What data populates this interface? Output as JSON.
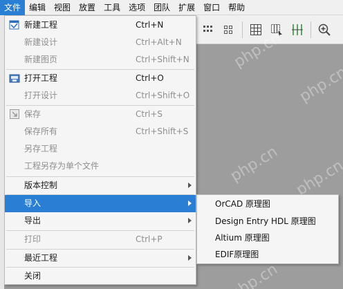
{
  "menubar": {
    "items": [
      "文件",
      "编辑",
      "视图",
      "放置",
      "工具",
      "选项",
      "团队",
      "扩展",
      "窗口",
      "帮助"
    ]
  },
  "file_menu": {
    "items": [
      {
        "label": "新建工程",
        "shortcut": "Ctrl+N",
        "enabled": true,
        "icon": "new-project-icon"
      },
      {
        "label": "新建设计",
        "shortcut": "Ctrl+Alt+N",
        "enabled": false
      },
      {
        "label": "新建图页",
        "shortcut": "Ctrl+Shift+N",
        "enabled": false
      },
      {
        "label": "打开工程",
        "shortcut": "Ctrl+O",
        "enabled": true,
        "icon": "open-project-icon"
      },
      {
        "label": "打开设计",
        "shortcut": "Ctrl+Shift+O",
        "enabled": false
      },
      {
        "label": "保存",
        "shortcut": "Ctrl+S",
        "enabled": false,
        "icon": "save-icon"
      },
      {
        "label": "保存所有",
        "shortcut": "Ctrl+Shift+S",
        "enabled": false
      },
      {
        "label": "另存工程",
        "shortcut": "",
        "enabled": false
      },
      {
        "label": "工程另存为单个文件",
        "shortcut": "",
        "enabled": false
      },
      {
        "label": "版本控制",
        "shortcut": "",
        "enabled": true,
        "submenu": true
      },
      {
        "label": "导入",
        "shortcut": "",
        "enabled": true,
        "submenu": true,
        "highlighted": true
      },
      {
        "label": "导出",
        "shortcut": "",
        "enabled": true,
        "submenu": true
      },
      {
        "label": "打印",
        "shortcut": "Ctrl+P",
        "enabled": false
      },
      {
        "label": "最近工程",
        "shortcut": "",
        "enabled": true,
        "submenu": true
      },
      {
        "label": "关闭",
        "shortcut": "",
        "enabled": true
      }
    ]
  },
  "import_submenu": {
    "items": [
      "OrCAD 原理图",
      "Design Entry HDL 原理图",
      "Altium 原理图",
      "EDIF原理图"
    ]
  },
  "toolbar": {
    "icons": [
      "grid-dots-icon",
      "grid-dots-icon",
      "grid-icon",
      "grid-select-icon",
      "columns-icon",
      "zoom-in-icon"
    ]
  },
  "watermark": "php.cn",
  "colors": {
    "accent": "#2a7fd4",
    "canvas": "#9d9d9d",
    "menu_bg": "#f5f5f5"
  }
}
